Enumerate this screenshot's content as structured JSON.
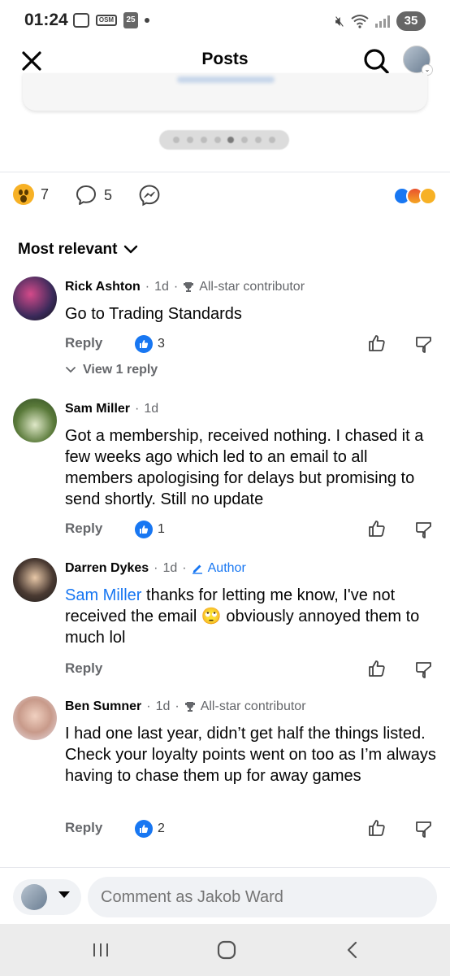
{
  "status_bar": {
    "time": "01:24",
    "calendar_day": "25",
    "battery": "35"
  },
  "header": {
    "title": "Posts"
  },
  "reactions": {
    "wow_count": "7",
    "comment_count": "5"
  },
  "sort": {
    "label": "Most relevant"
  },
  "comments": [
    {
      "name": "Rick Ashton",
      "time": "1d",
      "badge": "All-star contributor",
      "text": "Go to Trading Standards",
      "reply_label": "Reply",
      "likes": "3",
      "view_replies": "View 1 reply"
    },
    {
      "name": "Sam Miller",
      "time": "1d",
      "text": "Got a membership, received nothing. I chased it a few weeks ago which led to an email to all members apologising for delays but promising to send shortly. Still no update",
      "reply_label": "Reply",
      "likes": "1"
    },
    {
      "name": "Darren Dykes",
      "time": "1d",
      "badge": "Author",
      "mention": "Sam Miller",
      "text_before_emoji": " thanks for letting me know, I've not received the email ",
      "emoji": "🙄",
      "text_after_emoji": " obviously annoyed them to much lol",
      "reply_label": "Reply"
    },
    {
      "name": "Ben Sumner",
      "time": "1d",
      "badge": "All-star contributor",
      "text": "I had one last year, didn’t get half the things listed. Check your loyalty points went on too as I’m always having to chase them up for away games",
      "reply_label": "Reply",
      "likes": "2"
    }
  ],
  "composer": {
    "placeholder": "Comment as Jakob Ward"
  },
  "colors": {
    "accent": "#1877f2",
    "secondary_text": "#65676b"
  }
}
